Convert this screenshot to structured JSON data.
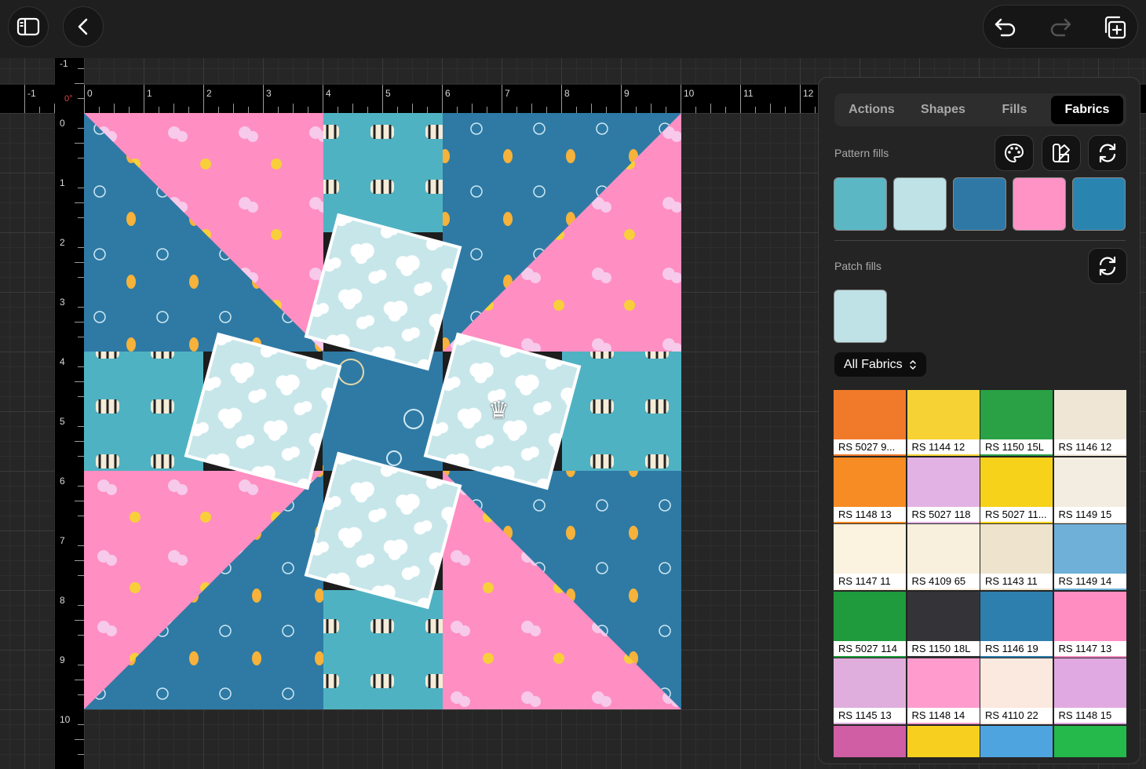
{
  "toolbar": {
    "sidebar_toggle": "sidebar-icon",
    "back": "chevron-left-icon",
    "undo": "undo-icon",
    "redo": "redo-icon",
    "add_block": "add-copy-icon"
  },
  "canvas": {
    "rotation_label": "0°",
    "ruler_x": [
      "-1",
      "0",
      "1",
      "2",
      "3",
      "4",
      "5",
      "6",
      "7",
      "8",
      "9",
      "10",
      "11",
      "12"
    ],
    "ruler_y": [
      "-1",
      "0",
      "1",
      "2",
      "3",
      "4",
      "5",
      "6",
      "7",
      "8",
      "9",
      "10"
    ],
    "crown_icon": "♛"
  },
  "panel": {
    "tabs": [
      {
        "label": "Actions",
        "active": false
      },
      {
        "label": "Shapes",
        "active": false
      },
      {
        "label": "Fills",
        "active": false
      },
      {
        "label": "Fabrics",
        "active": true
      }
    ],
    "pattern_fills_label": "Pattern fills",
    "patch_fills_label": "Patch fills",
    "filter_label": "All Fabrics",
    "pattern_swatches": [
      "#5bb7c4",
      "#bfe2e6",
      "#2f78a6",
      "#ff93c6",
      "#2a84b0"
    ],
    "patch_swatch": "#bfe2e6",
    "fabrics": [
      {
        "label": "RS 5027 9...",
        "color": "#f17a2a"
      },
      {
        "label": "RS 1144 12",
        "color": "#f6d234"
      },
      {
        "label": "RS 1150 15L",
        "color": "#2aa145"
      },
      {
        "label": "RS 1146 12",
        "color": "#efe6d6"
      },
      {
        "label": "RS 1148 13",
        "color": "#f78b24"
      },
      {
        "label": "RS 5027 118",
        "color": "#e3b2e4"
      },
      {
        "label": "RS 5027 11...",
        "color": "#f6d21a"
      },
      {
        "label": "RS 1149 15",
        "color": "#f2ede0"
      },
      {
        "label": "RS 1147 11",
        "color": "#fbf2e0"
      },
      {
        "label": "RS 4109 65",
        "color": "#f9efdd"
      },
      {
        "label": "RS 1143 11",
        "color": "#eee3cd"
      },
      {
        "label": "RS 1149 14",
        "color": "#6fb0d8"
      },
      {
        "label": "RS 5027 114",
        "color": "#1f9b3d"
      },
      {
        "label": "RS 1150 18L",
        "color": "#333338"
      },
      {
        "label": "RS 1146 19",
        "color": "#2d7fae"
      },
      {
        "label": "RS 1147 13",
        "color": "#ff8dc2"
      },
      {
        "label": "RS 1145 13",
        "color": "#dfaedc"
      },
      {
        "label": "RS 1148 14",
        "color": "#ff9ccd"
      },
      {
        "label": "RS 4110 22",
        "color": "#fbe8de"
      },
      {
        "label": "RS 1148 15",
        "color": "#e1a9e2"
      }
    ],
    "partial_row": [
      "#cf5ea4",
      "#f7cf1f",
      "#4ea4de",
      "#25b84b"
    ]
  }
}
